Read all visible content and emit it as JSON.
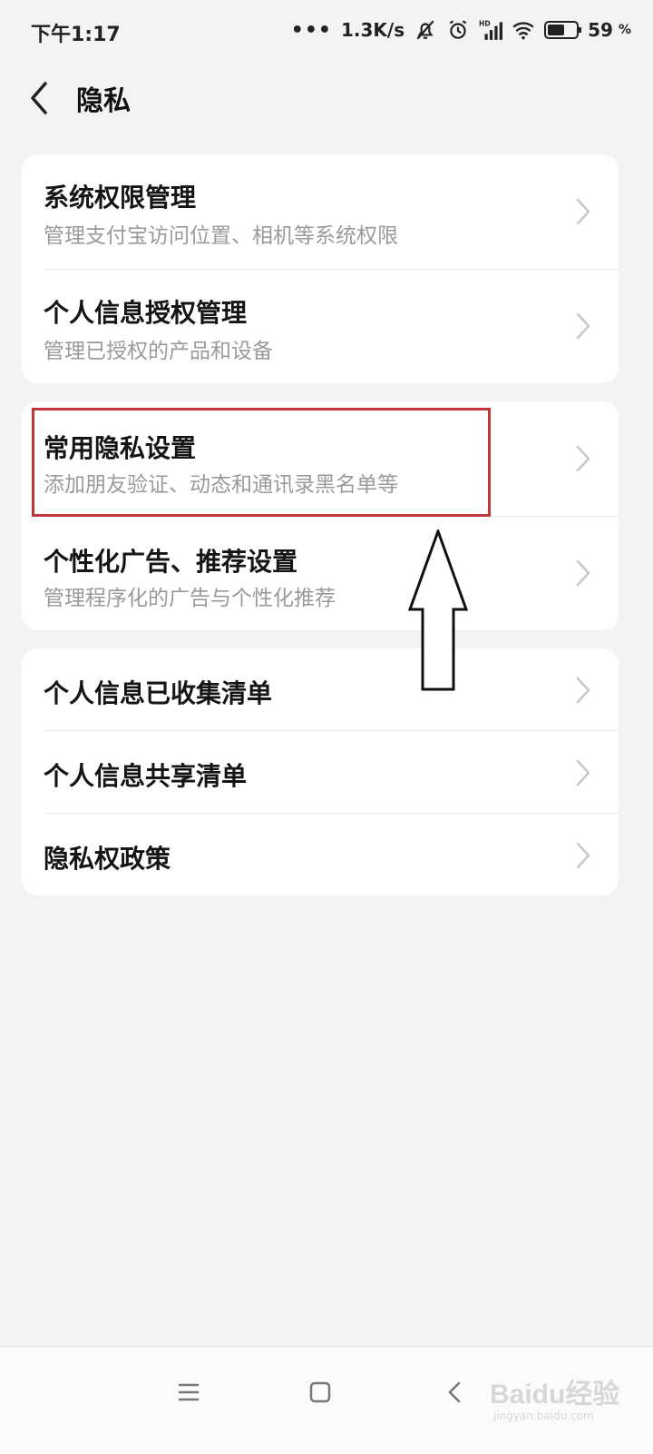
{
  "status_bar": {
    "time": "下午1:17",
    "net_speed": "1.3K/s",
    "battery": "59",
    "battery_unit": "%",
    "icons": [
      "more-dots-icon",
      "mute-bell-icon",
      "alarm-icon",
      "hd-signal-icon",
      "wifi-icon",
      "battery-icon"
    ]
  },
  "header": {
    "back_icon": "chevron-left-icon",
    "title": "隐私"
  },
  "sections": [
    {
      "items": [
        {
          "title": "系统权限管理",
          "subtitle": "管理支付宝访问位置、相机等系统权限"
        },
        {
          "title": "个人信息授权管理",
          "subtitle": "管理已授权的产品和设备"
        }
      ]
    },
    {
      "items": [
        {
          "title": "常用隐私设置",
          "subtitle": "添加朋友验证、动态和通讯录黑名单等"
        },
        {
          "title": "个性化广告、推荐设置",
          "subtitle": "管理程序化的广告与个性化推荐"
        }
      ]
    },
    {
      "items": [
        {
          "title": "个人信息已收集清单"
        },
        {
          "title": "个人信息共享清单"
        },
        {
          "title": "隐私权政策"
        }
      ]
    }
  ],
  "annotation": {
    "box_color": "#c0363a",
    "target": "常用隐私设置",
    "arrow": "up-arrow-outline"
  },
  "nav_bar": {
    "icons": [
      "menu-icon",
      "home-square-icon",
      "back-chevron-icon"
    ]
  },
  "watermark": {
    "text": "Baidu经验",
    "url": "jingyan.baidu.com"
  },
  "colors": {
    "background": "#f3f3f3",
    "card": "#ffffff",
    "subtitle": "#9a9a9a"
  }
}
